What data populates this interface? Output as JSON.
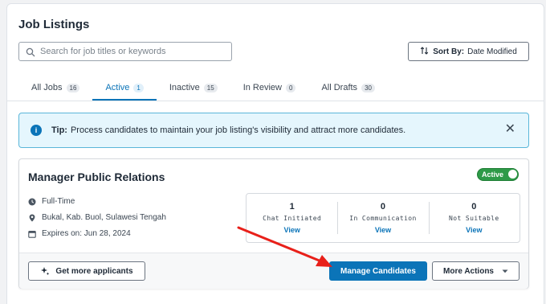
{
  "header": {
    "title": "Job Listings"
  },
  "search": {
    "placeholder": "Search for job titles or keywords"
  },
  "sort": {
    "label": "Sort By:",
    "value": "Date Modified"
  },
  "tabs": [
    {
      "label": "All Jobs",
      "count": "16"
    },
    {
      "label": "Active",
      "count": "1"
    },
    {
      "label": "Inactive",
      "count": "15"
    },
    {
      "label": "In Review",
      "count": "0"
    },
    {
      "label": "All Drafts",
      "count": "30"
    }
  ],
  "active_tab": "Active",
  "tip": {
    "label": "Tip:",
    "text": "Process candidates to maintain your job listing's visibility and attract more candidates.",
    "close": "✕"
  },
  "job": {
    "title": "Manager Public Relations",
    "status": "Active",
    "type": "Full-Time",
    "location": "Bukal, Kab. Buol, Sulawesi Tengah",
    "expires": "Expires on: Jun 28, 2024",
    "stats": [
      {
        "value": "1",
        "label": "Chat Initiated",
        "action": "View"
      },
      {
        "value": "0",
        "label": "In Communication",
        "action": "View"
      },
      {
        "value": "0",
        "label": "Not Suitable",
        "action": "View"
      }
    ]
  },
  "actions": {
    "get_more": "Get more applicants",
    "manage": "Manage Candidates",
    "more": "More Actions"
  },
  "colors": {
    "primary": "#0b74b8",
    "active_green": "#2e9a48",
    "tip_bg": "#e5f6fd",
    "annotation_arrow": "#e8201a"
  },
  "icons": [
    "search-icon",
    "sort-icon",
    "info-icon",
    "close-icon",
    "clock-icon",
    "location-pin-icon",
    "calendar-icon",
    "sparkle-icon",
    "chevron-down-icon"
  ]
}
